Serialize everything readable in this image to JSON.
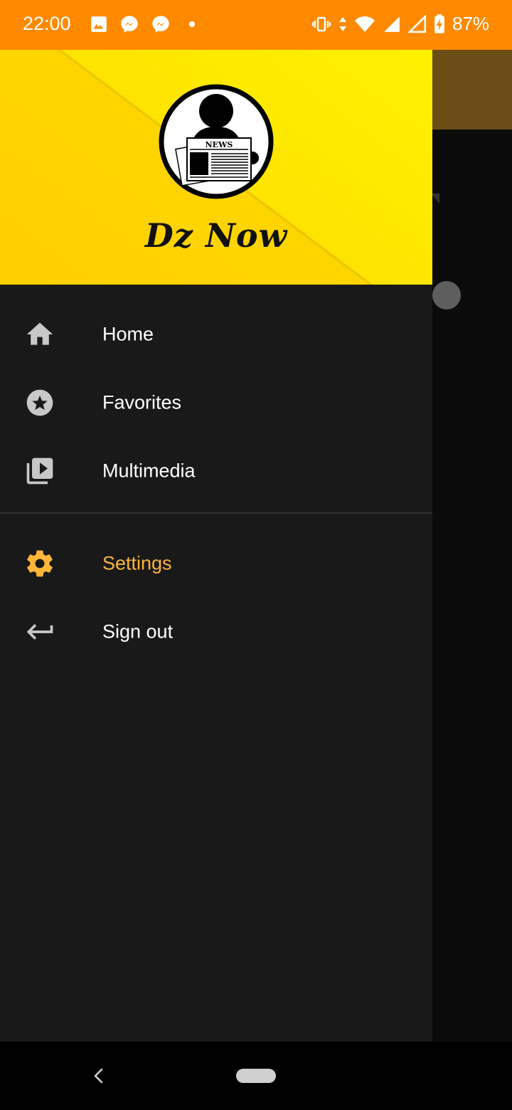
{
  "status_bar": {
    "time": "22:00",
    "battery": "87%",
    "left_icons": [
      "image-icon",
      "messenger-icon",
      "messenger-icon",
      "dot-icon"
    ],
    "right_icons": [
      "vibrate-icon",
      "data-arrows-icon",
      "wifi-icon",
      "signal-icon",
      "signal-icon",
      "battery-charging-icon"
    ]
  },
  "drawer": {
    "header": {
      "app_name": "Dz Now",
      "logo_text": "NEWS"
    },
    "primary_items": [
      {
        "label": "Home",
        "icon": "home-icon"
      },
      {
        "label": "Favorites",
        "icon": "star-circle-icon"
      },
      {
        "label": "Multimedia",
        "icon": "video-library-icon"
      }
    ],
    "secondary_items": [
      {
        "label": "Settings",
        "icon": "gear-icon",
        "active": true
      },
      {
        "label": "Sign out",
        "icon": "sign-out-arrow-icon"
      }
    ]
  },
  "colors": {
    "status_bar": "#ff8a00",
    "header": "#ffe400",
    "drawer_bg": "#1a191a",
    "active": "#ffb53a",
    "icon": "#c8c8c8"
  }
}
